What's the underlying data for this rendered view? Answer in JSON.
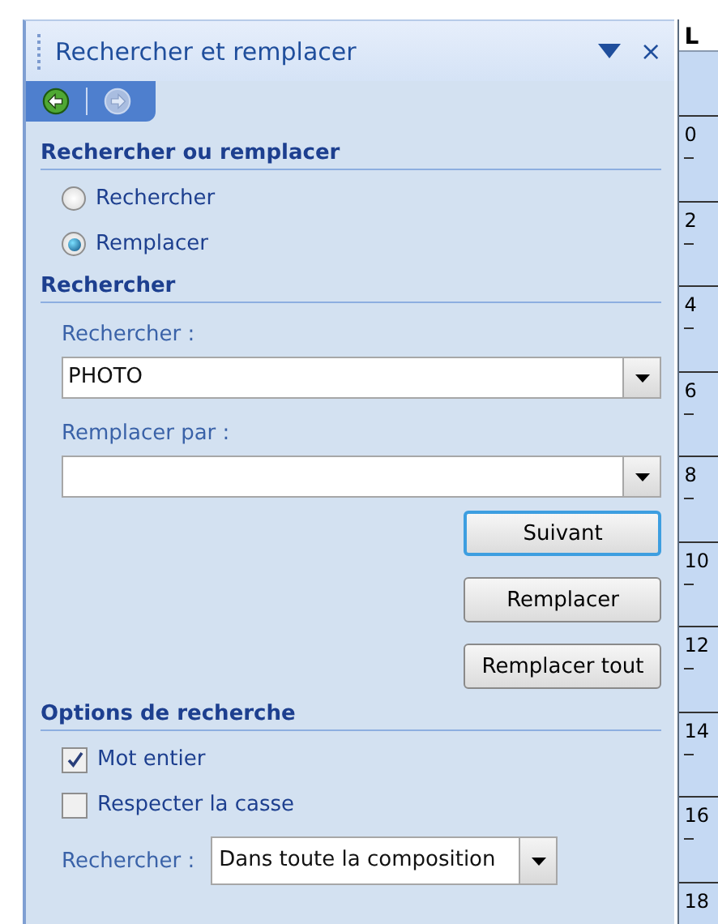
{
  "panel": {
    "title": "Rechercher et remplacer",
    "close": "×"
  },
  "nav": [
    {
      "kind": "back",
      "disabled": false
    },
    {
      "kind": "forward",
      "disabled": true
    }
  ],
  "mode": {
    "heading": "Rechercher ou remplacer",
    "options": [
      {
        "label": "Rechercher",
        "selected": false
      },
      {
        "label": "Remplacer",
        "selected": true
      }
    ]
  },
  "search": {
    "heading": "Rechercher",
    "find": {
      "label": "Rechercher :",
      "value": "PHOTO"
    },
    "replace": {
      "label": "Remplacer par :"
    },
    "buttons": [
      {
        "label": "Suivant",
        "default": true
      },
      {
        "label": "Remplacer",
        "default": false
      },
      {
        "label": "Remplacer tout",
        "default": false
      }
    ]
  },
  "options": {
    "heading": "Options de recherche",
    "checks": [
      {
        "label": "Mot entier",
        "checked": true
      },
      {
        "label": "Respecter la casse",
        "checked": false
      }
    ],
    "scope": {
      "label": "Rechercher :",
      "value": "Dans toute la composition"
    }
  },
  "ruler": {
    "corner": "L",
    "labels": [
      "0",
      "2",
      "4",
      "6",
      "8",
      "10",
      "12",
      "14",
      "16",
      "18"
    ]
  }
}
